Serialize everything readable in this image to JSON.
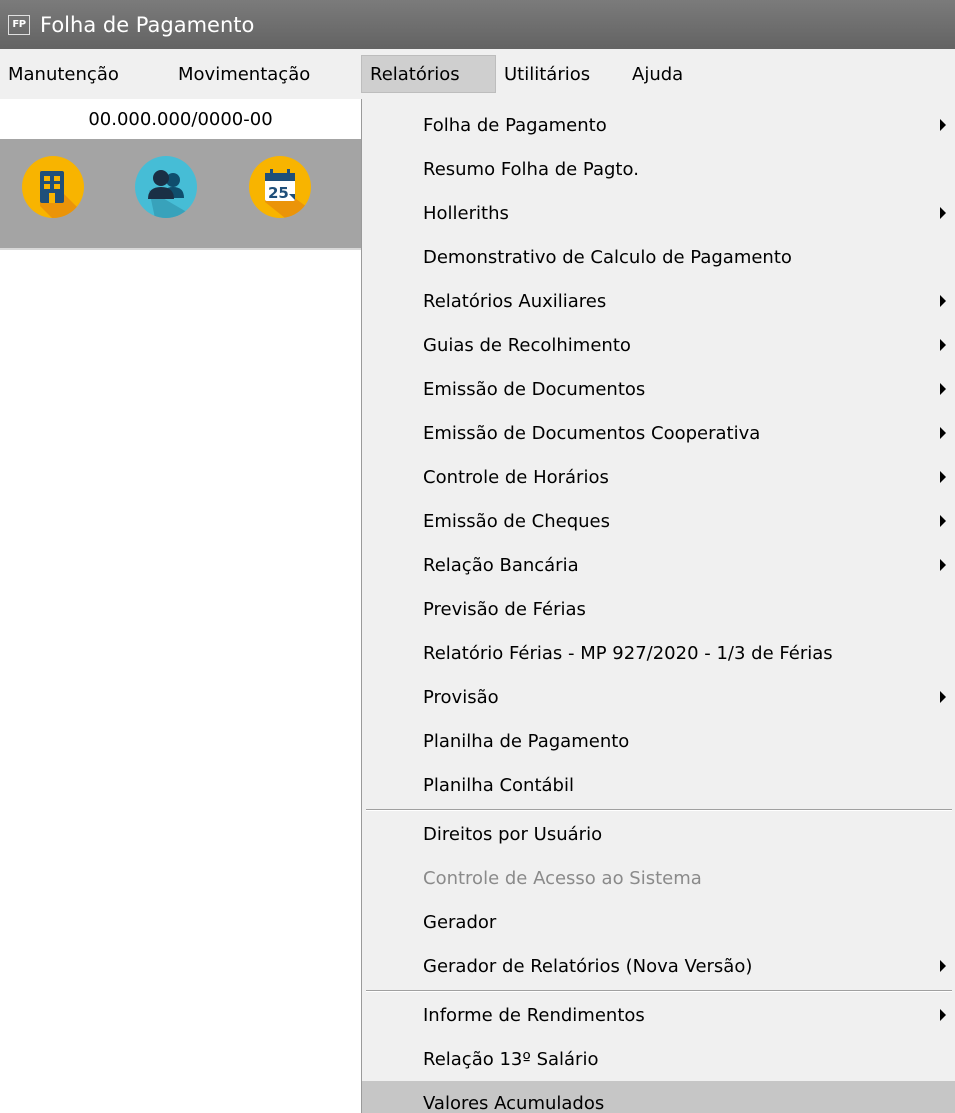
{
  "window": {
    "icon_text": "FP",
    "title": "Folha de Pagamento"
  },
  "menubar": {
    "items": [
      {
        "label": "Manutenção"
      },
      {
        "label": "Movimentação"
      },
      {
        "label": "Relatórios",
        "active": true
      },
      {
        "label": "Utilitários"
      },
      {
        "label": "Ajuda"
      }
    ]
  },
  "company": {
    "cnpj": "00.000.000/0000-00"
  },
  "toolbar": {
    "buttons": [
      {
        "icon": "building-icon",
        "color": "#f8b400"
      },
      {
        "icon": "users-icon",
        "color": "#46bdd6"
      },
      {
        "icon": "calendar-icon",
        "color": "#f8b400",
        "text": "25"
      }
    ]
  },
  "dropdown": {
    "items": [
      {
        "label": "Folha de Pagamento",
        "submenu": true
      },
      {
        "label": "Resumo Folha de Pagto.",
        "submenu": false
      },
      {
        "label": "Holleriths",
        "submenu": true
      },
      {
        "label": "Demonstrativo de Calculo de Pagamento",
        "submenu": false
      },
      {
        "label": "Relatórios Auxiliares",
        "submenu": true
      },
      {
        "label": "Guias de Recolhimento",
        "submenu": true
      },
      {
        "label": "Emissão de Documentos",
        "submenu": true
      },
      {
        "label": "Emissão de Documentos Cooperativa",
        "submenu": true
      },
      {
        "label": "Controle de Horários",
        "submenu": true
      },
      {
        "label": "Emissão de Cheques",
        "submenu": true
      },
      {
        "label": "Relação Bancária",
        "submenu": true
      },
      {
        "label": "Previsão de Férias",
        "submenu": false
      },
      {
        "label": "Relatório Férias - MP 927/2020 - 1/3 de Férias",
        "submenu": false
      },
      {
        "label": "Provisão",
        "submenu": true
      },
      {
        "label": "Planilha de Pagamento",
        "submenu": false
      },
      {
        "label": "Planilha Contábil",
        "submenu": false
      },
      {
        "label": "Direitos por Usuário",
        "submenu": false
      },
      {
        "label": "Controle de Acesso ao Sistema",
        "submenu": false,
        "disabled": true
      },
      {
        "label": "Gerador",
        "submenu": false
      },
      {
        "label": "Gerador de Relatórios (Nova Versão)",
        "submenu": true
      },
      {
        "label": "Informe de Rendimentos",
        "submenu": true
      },
      {
        "label": "Relação 13º Salário",
        "submenu": false
      },
      {
        "label": "Valores Acumulados",
        "submenu": false,
        "highlighted": true
      }
    ]
  }
}
